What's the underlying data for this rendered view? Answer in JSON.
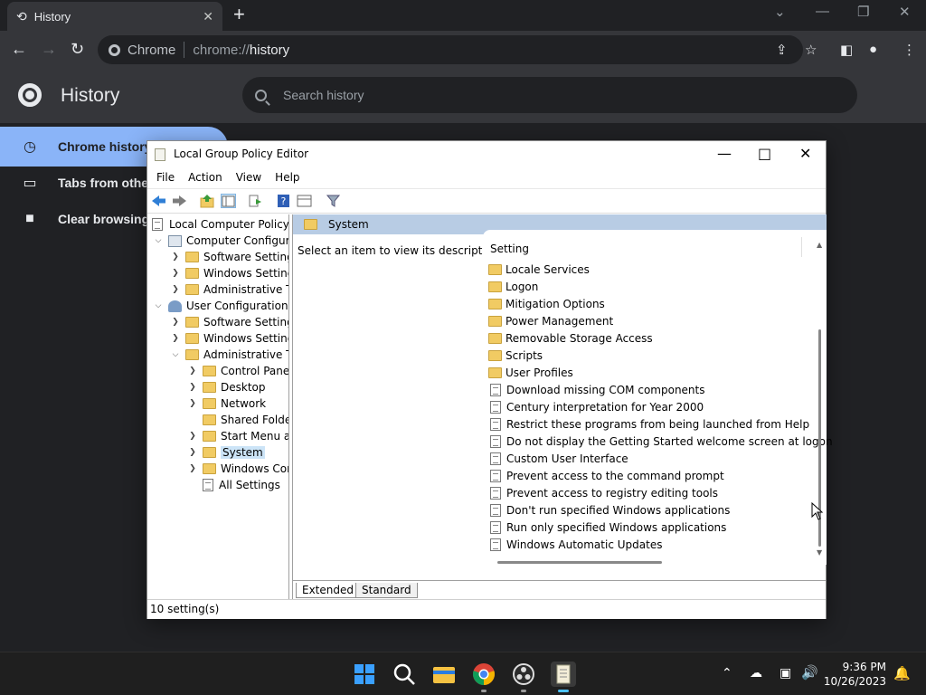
{
  "browser": {
    "tab_title": "History",
    "omnibox_chip": "Chrome",
    "omnibox_scheme": "chrome://",
    "omnibox_host": "history"
  },
  "history_page": {
    "title": "History",
    "search_placeholder": "Search history",
    "sidebar": [
      {
        "label": "Chrome history"
      },
      {
        "label": "Tabs from other"
      },
      {
        "label": "Clear browsing"
      }
    ]
  },
  "gpedit": {
    "title": "Local Group Policy Editor",
    "menu": [
      "File",
      "Action",
      "View",
      "Help"
    ],
    "tree": [
      {
        "label": "Local Computer Policy"
      },
      {
        "label": "Computer Configura"
      },
      {
        "label": "Software Settings"
      },
      {
        "label": "Windows Setting"
      },
      {
        "label": "Administrative Te"
      },
      {
        "label": "User Configuration"
      },
      {
        "label": "Software Settings"
      },
      {
        "label": "Windows Setting"
      },
      {
        "label": "Administrative Te"
      },
      {
        "label": "Control Panel"
      },
      {
        "label": "Desktop"
      },
      {
        "label": "Network"
      },
      {
        "label": "Shared Folder"
      },
      {
        "label": "Start Menu ar"
      },
      {
        "label": "System"
      },
      {
        "label": "Windows Cor"
      },
      {
        "label": "All Settings"
      }
    ],
    "section_title": "System",
    "description": "Select an item to view its description.",
    "column_header": "Setting",
    "settings": [
      {
        "label": "Locale Services",
        "kind": "folder"
      },
      {
        "label": "Logon",
        "kind": "folder"
      },
      {
        "label": "Mitigation Options",
        "kind": "folder"
      },
      {
        "label": "Power Management",
        "kind": "folder"
      },
      {
        "label": "Removable Storage Access",
        "kind": "folder"
      },
      {
        "label": "Scripts",
        "kind": "folder"
      },
      {
        "label": "User Profiles",
        "kind": "folder"
      },
      {
        "label": "Download missing COM components",
        "kind": "policy"
      },
      {
        "label": "Century interpretation for Year 2000",
        "kind": "policy"
      },
      {
        "label": "Restrict these programs from being launched from Help",
        "kind": "policy"
      },
      {
        "label": "Do not display the Getting Started welcome screen at logon",
        "kind": "policy"
      },
      {
        "label": "Custom User Interface",
        "kind": "policy"
      },
      {
        "label": "Prevent access to the command prompt",
        "kind": "policy"
      },
      {
        "label": "Prevent access to registry editing tools",
        "kind": "policy"
      },
      {
        "label": "Don't run specified Windows applications",
        "kind": "policy"
      },
      {
        "label": "Run only specified Windows applications",
        "kind": "policy"
      },
      {
        "label": "Windows Automatic Updates",
        "kind": "policy"
      }
    ],
    "tabs": [
      "Extended",
      "Standard"
    ],
    "status": "10 setting(s)"
  },
  "taskbar": {
    "time": "9:36 PM",
    "date": "10/26/2023"
  },
  "colors": {
    "accent": "#8ab4f8",
    "section_header": "#b8cce4",
    "folder": "#f1cb63"
  }
}
